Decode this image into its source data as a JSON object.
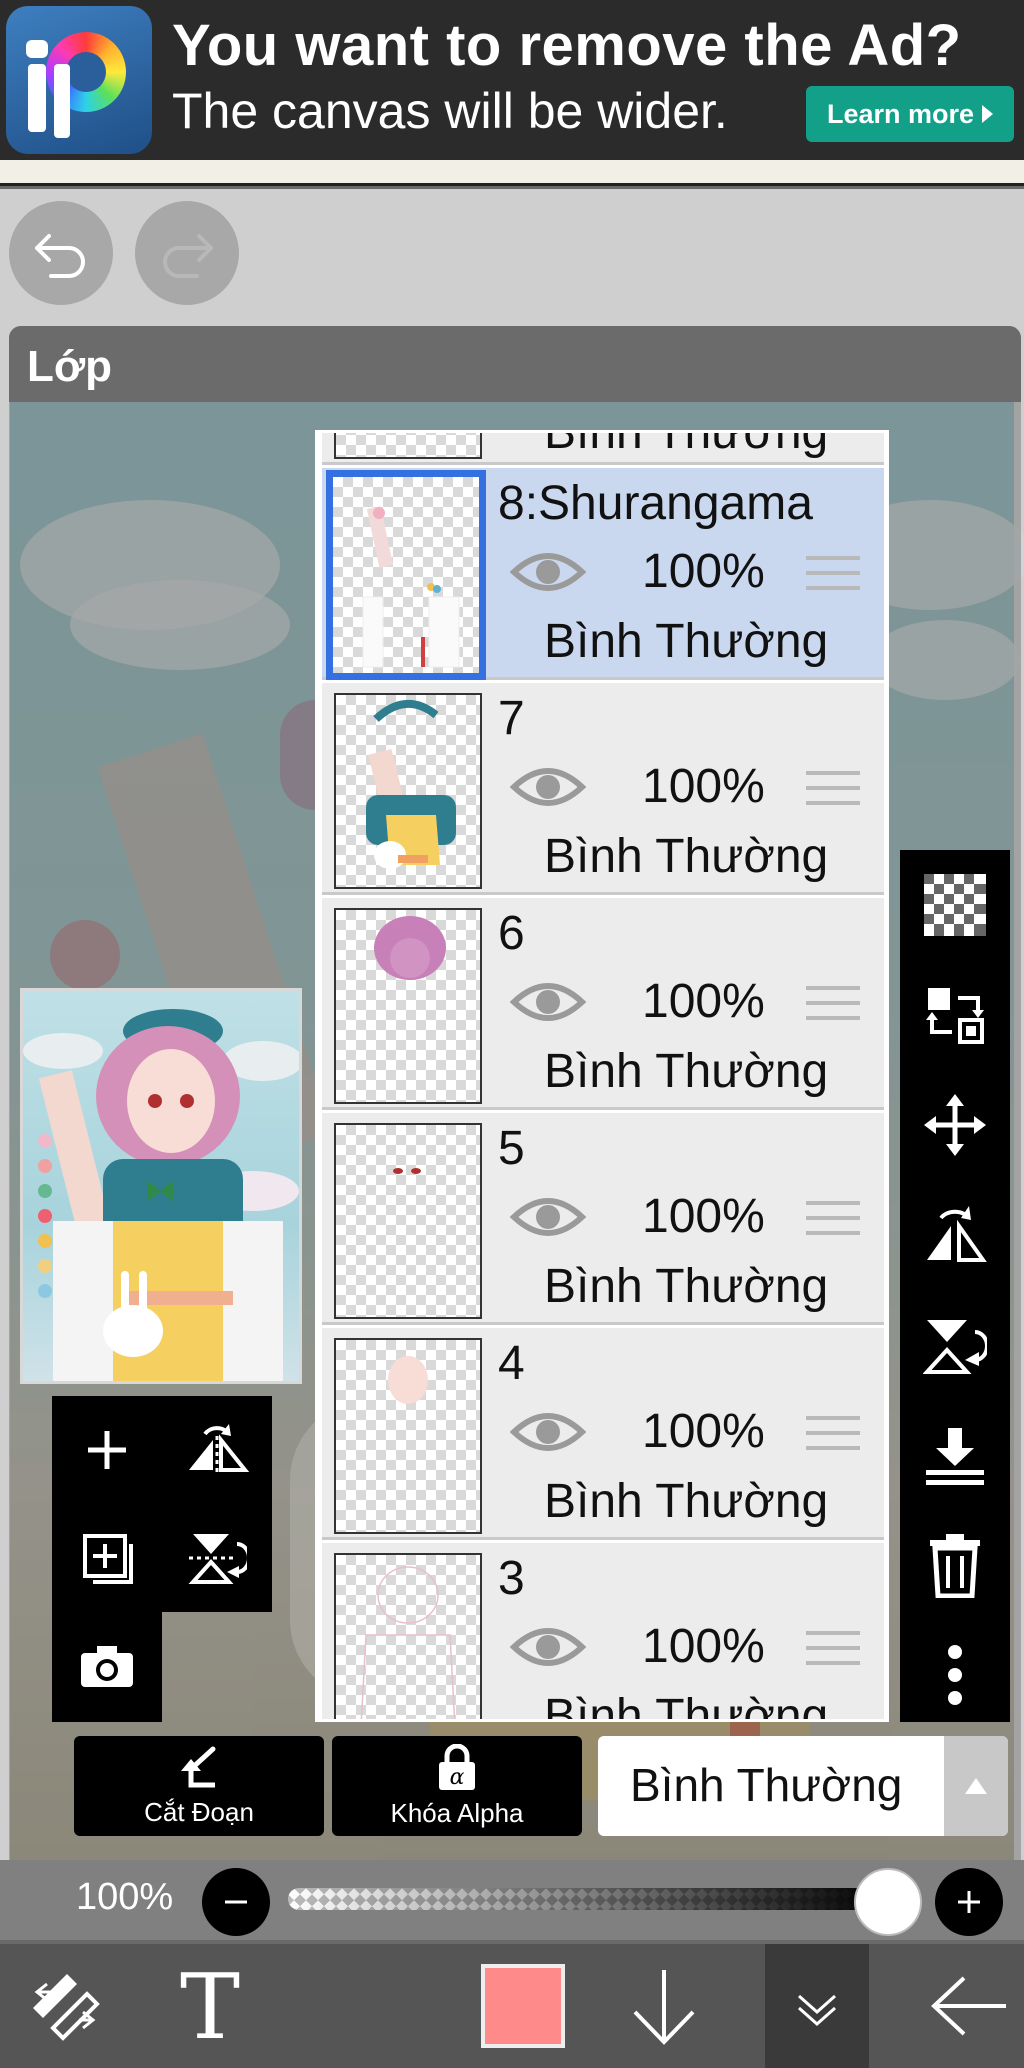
{
  "ad": {
    "title": "You want to remove the Ad?",
    "subtitle": "The canvas will be wider.",
    "button_label": "Learn more"
  },
  "panel": {
    "title": "Lớp"
  },
  "layers": [
    {
      "name": "8:Shurangama",
      "opacity": "100%",
      "blend": "Bình Thường",
      "selected": true
    },
    {
      "name": "7",
      "opacity": "100%",
      "blend": "Bình Thường",
      "selected": false
    },
    {
      "name": "6",
      "opacity": "100%",
      "blend": "Bình Thường",
      "selected": false
    },
    {
      "name": "5",
      "opacity": "100%",
      "blend": "Bình Thường",
      "selected": false
    },
    {
      "name": "4",
      "opacity": "100%",
      "blend": "Bình Thường",
      "selected": false
    },
    {
      "name": "3",
      "opacity": "100%",
      "blend": "Bình Thường",
      "selected": false
    }
  ],
  "partial_top_blend": "Bình Thường",
  "partial_bottom_blend": "Bình Thường",
  "controls": {
    "clip_label": "Cắt Đoạn",
    "alpha_label": "Khóa Alpha",
    "blend_mode": "Bình Thường",
    "opacity_label": "100%",
    "opacity_value": 1.0
  },
  "colors": {
    "current_color": "#ff8a8a",
    "selected_layer_bg": "#cad8ef",
    "selection_border": "#3470e0",
    "ad_button": "#12a089"
  },
  "icons": {
    "left_tools": [
      "add-layer-icon",
      "flip-horizontal-icon",
      "duplicate-layer-icon",
      "flip-vertical-icon",
      "camera-icon"
    ],
    "right_tools": [
      "transparency-icon",
      "swap-layers-icon",
      "move-icon",
      "flip-h-icon",
      "flip-v-icon",
      "merge-down-icon",
      "trash-icon",
      "more-icon"
    ],
    "bottom_bar": [
      "transform-tool-icon",
      "text-tool-icon",
      "color-swatch",
      "down-arrow-icon",
      "collapse-icon",
      "back-arrow-icon"
    ]
  }
}
